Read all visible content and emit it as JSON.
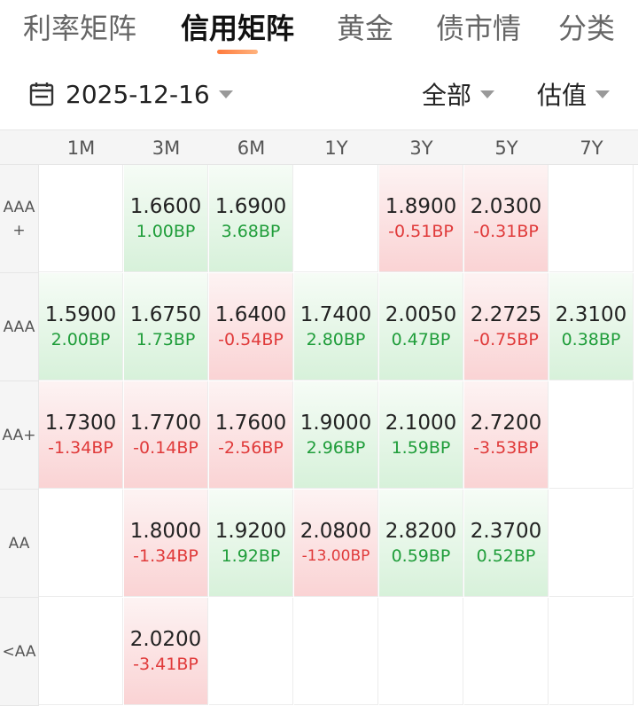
{
  "tabs": [
    {
      "label": "利率矩阵",
      "active": false
    },
    {
      "label": "信用矩阵",
      "active": true
    },
    {
      "label": "黄金",
      "active": false
    },
    {
      "label": "债市情",
      "active": false
    },
    {
      "label": "分类",
      "active": false
    }
  ],
  "filters": {
    "date": "2025-12-16",
    "scope": "全部",
    "metric": "估值"
  },
  "colors": {
    "up": "#1f9d3a",
    "down": "#e03a3a",
    "accent": "#ff7a3c"
  },
  "matrix": {
    "columns": [
      "1M",
      "3M",
      "6M",
      "1Y",
      "3Y",
      "5Y",
      "7Y"
    ],
    "rows": [
      {
        "label": "AAA\n+",
        "cells": [
          null,
          {
            "value": "1.6600",
            "change": "1.00BP",
            "dir": "up"
          },
          {
            "value": "1.6900",
            "change": "3.68BP",
            "dir": "up"
          },
          null,
          {
            "value": "1.8900",
            "change": "-0.51BP",
            "dir": "down"
          },
          {
            "value": "2.0300",
            "change": "-0.31BP",
            "dir": "down"
          },
          null
        ]
      },
      {
        "label": "AAA",
        "cells": [
          {
            "value": "1.5900",
            "change": "2.00BP",
            "dir": "up"
          },
          {
            "value": "1.6750",
            "change": "1.73BP",
            "dir": "up"
          },
          {
            "value": "1.6400",
            "change": "-0.54BP",
            "dir": "down"
          },
          {
            "value": "1.7400",
            "change": "2.80BP",
            "dir": "up"
          },
          {
            "value": "2.0050",
            "change": "0.47BP",
            "dir": "up"
          },
          {
            "value": "2.2725",
            "change": "-0.75BP",
            "dir": "down"
          },
          {
            "value": "2.3100",
            "change": "0.38BP",
            "dir": "up"
          }
        ]
      },
      {
        "label": "AA+",
        "cells": [
          {
            "value": "1.7300",
            "change": "-1.34BP",
            "dir": "down"
          },
          {
            "value": "1.7700",
            "change": "-0.14BP",
            "dir": "down"
          },
          {
            "value": "1.7600",
            "change": "-2.56BP",
            "dir": "down"
          },
          {
            "value": "1.9000",
            "change": "2.96BP",
            "dir": "up"
          },
          {
            "value": "2.1000",
            "change": "1.59BP",
            "dir": "up"
          },
          {
            "value": "2.7200",
            "change": "-3.53BP",
            "dir": "down"
          },
          null
        ]
      },
      {
        "label": "AA",
        "cells": [
          null,
          {
            "value": "1.8000",
            "change": "-1.34BP",
            "dir": "down"
          },
          {
            "value": "1.9200",
            "change": "1.92BP",
            "dir": "up"
          },
          {
            "value": "2.0800",
            "change": "-13.00BP",
            "dir": "down"
          },
          {
            "value": "2.8200",
            "change": "0.59BP",
            "dir": "up"
          },
          {
            "value": "2.3700",
            "change": "0.52BP",
            "dir": "up"
          },
          null
        ]
      },
      {
        "label": "<AA",
        "cells": [
          null,
          {
            "value": "2.0200",
            "change": "-3.41BP",
            "dir": "down"
          },
          null,
          null,
          null,
          null,
          null
        ]
      }
    ]
  }
}
